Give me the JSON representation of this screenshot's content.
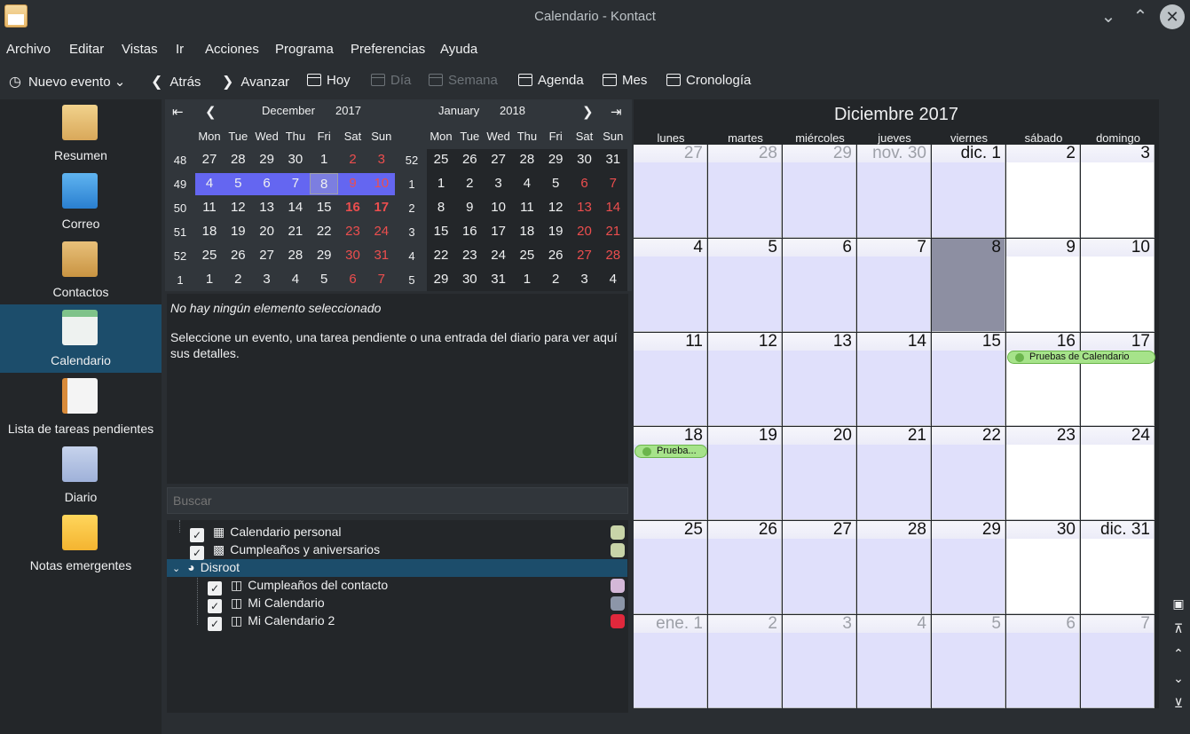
{
  "window": {
    "title": "Calendario - Kontact"
  },
  "menu": [
    "Archivo",
    "Editar",
    "Vistas",
    "Ir",
    "Acciones",
    "Programa",
    "Preferencias",
    "Ayuda"
  ],
  "toolbar": {
    "new_event": "Nuevo evento",
    "back": "Atrás",
    "forward": "Avanzar",
    "today": "Hoy",
    "day": "Día",
    "week": "Semana",
    "agenda": "Agenda",
    "month": "Mes",
    "timeline": "Cronología"
  },
  "sidebar": [
    {
      "label": "Resumen",
      "icon": "summary-icon"
    },
    {
      "label": "Correo",
      "icon": "mail-icon"
    },
    {
      "label": "Contactos",
      "icon": "contacts-icon"
    },
    {
      "label": "Calendario",
      "icon": "calendar-icon",
      "selected": true
    },
    {
      "label": "Lista de tareas pendientes",
      "icon": "todo-icon"
    },
    {
      "label": "Diario",
      "icon": "journal-icon"
    },
    {
      "label": "Notas emergentes",
      "icon": "notes-icon"
    }
  ],
  "mini_calendar": {
    "left": {
      "month": "December",
      "year": "2017"
    },
    "right": {
      "month": "January",
      "year": "2018"
    },
    "weekdays": [
      "Mon",
      "Tue",
      "Wed",
      "Thu",
      "Fri",
      "Sat",
      "Sun"
    ],
    "left_weeks": [
      "48",
      "49",
      "50",
      "51",
      "52",
      "1"
    ],
    "right_weeks": [
      "52",
      "1",
      "2",
      "3",
      "4",
      "5"
    ],
    "left_days": [
      [
        "27",
        "28",
        "29",
        "30",
        "1",
        "2",
        "3"
      ],
      [
        "4",
        "5",
        "6",
        "7",
        "8",
        "9",
        "10"
      ],
      [
        "11",
        "12",
        "13",
        "14",
        "15",
        "16",
        "17"
      ],
      [
        "18",
        "19",
        "20",
        "21",
        "22",
        "23",
        "24"
      ],
      [
        "25",
        "26",
        "27",
        "28",
        "29",
        "30",
        "31"
      ],
      [
        "1",
        "2",
        "3",
        "4",
        "5",
        "6",
        "7"
      ]
    ],
    "right_days": [
      [
        "25",
        "26",
        "27",
        "28",
        "29",
        "30",
        "31"
      ],
      [
        "1",
        "2",
        "3",
        "4",
        "5",
        "6",
        "7"
      ],
      [
        "8",
        "9",
        "10",
        "11",
        "12",
        "13",
        "14"
      ],
      [
        "15",
        "16",
        "17",
        "18",
        "19",
        "20",
        "21"
      ],
      [
        "22",
        "23",
        "24",
        "25",
        "26",
        "27",
        "28"
      ],
      [
        "29",
        "30",
        "31",
        "1",
        "2",
        "3",
        "4"
      ]
    ]
  },
  "detail": {
    "heading": "No hay ningún elemento seleccionado",
    "body": "Seleccione un evento, una tarea pendiente o una entrada del diario para ver aquí sus detalles."
  },
  "search": {
    "placeholder": "Buscar"
  },
  "calendars": [
    {
      "label": "Calendario personal",
      "color": "#c8d4a8",
      "icon": "calendar-icon",
      "level": 1
    },
    {
      "label": "Cumpleaños y aniversarios",
      "color": "#c8d4a8",
      "icon": "cake-icon",
      "level": 1
    },
    {
      "label": "Disroot",
      "icon": "globe-icon",
      "level": 0,
      "selected": true
    },
    {
      "label": "Cumpleaños del contacto",
      "color": "#d4b8d8",
      "icon": "folder-icon",
      "level": 2
    },
    {
      "label": "Mi Calendario",
      "color": "#8c96a8",
      "icon": "folder-icon",
      "level": 2
    },
    {
      "label": "Mi Calendario 2",
      "color": "#e0283c",
      "icon": "folder-icon",
      "level": 2
    }
  ],
  "month_view": {
    "title": "Diciembre 2017",
    "weekdays": [
      "lunes",
      "martes",
      "miércoles",
      "jueves",
      "viernes",
      "sábado",
      "domingo"
    ],
    "weeks": [
      [
        "27",
        "28",
        "29",
        "nov. 30",
        "dic. 1",
        "2",
        "3"
      ],
      [
        "4",
        "5",
        "6",
        "7",
        "8",
        "9",
        "10"
      ],
      [
        "11",
        "12",
        "13",
        "14",
        "15",
        "16",
        "17"
      ],
      [
        "18",
        "19",
        "20",
        "21",
        "22",
        "23",
        "24"
      ],
      [
        "25",
        "26",
        "27",
        "28",
        "29",
        "30",
        "dic. 31"
      ],
      [
        "ene. 1",
        "2",
        "3",
        "4",
        "5",
        "6",
        "7"
      ]
    ],
    "events": [
      {
        "label": "Pruebas de Calendario"
      },
      {
        "label": "Prueba..."
      }
    ]
  }
}
